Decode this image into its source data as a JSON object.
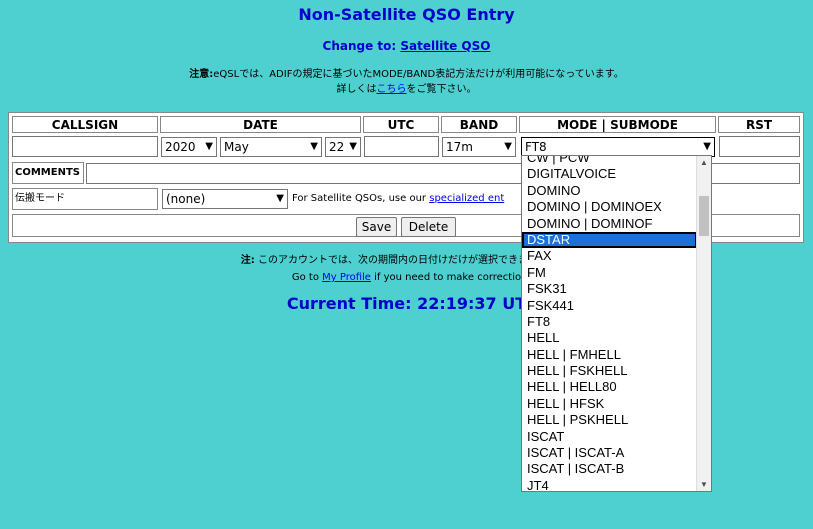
{
  "page": {
    "title": "Non-Satellite QSO Entry",
    "change_prefix": "Change to: ",
    "change_link": "Satellite QSO",
    "note1_bold": "注意:",
    "note1_text": "eQSLでは、ADIFの規定に基づいたMODE/BAND表記方法だけが利用可能になっています。",
    "note1_line2_pre": "詳しくは",
    "note1_line2_link": "こちら",
    "note1_line2_post": "をご覧下さい。",
    "note2_bold": "注:",
    "note2_text": " このアカウントでは、次の期間内の日付けだけが選択できます: 01-Fe",
    "note3_pre": "Go to ",
    "note3_link": "My Profile",
    "note3_post": " if you need to make correctio",
    "current_time": "Current Time: 22:19:37 UT"
  },
  "form": {
    "headers": {
      "callsign": "CALLSIGN",
      "date": "DATE",
      "utc": "UTC",
      "band": "BAND",
      "mode": "MODE | SUBMODE",
      "rst": "RST"
    },
    "callsign_value": "",
    "year": "2020",
    "month": "May",
    "day": "22",
    "utc_value": "",
    "band": "17m",
    "mode": "FT8",
    "rst_value": "",
    "comments_label": "COMMENTS",
    "comments_value": "",
    "prop_label": "伝搬モード",
    "prop_value": "(none)",
    "sat_note_pre": "For Satellite QSOs, use our ",
    "sat_note_link": "specialized ent",
    "save_label": "Save",
    "delete_label": "Delete"
  },
  "mode_dropdown": {
    "items": [
      "CW | PCW",
      "DIGITALVOICE",
      "DOMINO",
      "DOMINO | DOMINOEX",
      "DOMINO | DOMINOF",
      "DSTAR",
      "FAX",
      "FM",
      "FSK31",
      "FSK441",
      "FT8",
      "HELL",
      "HELL | FMHELL",
      "HELL | FSKHELL",
      "HELL | HELL80",
      "HELL | HFSK",
      "HELL | PSKHELL",
      "ISCAT",
      "ISCAT | ISCAT-A",
      "ISCAT | ISCAT-B",
      "JT4"
    ],
    "highlighted": "DSTAR"
  },
  "icons": {
    "chevron": "chevron-down-icon",
    "scroll_up": "scroll-up-icon",
    "scroll_down": "scroll-down-icon"
  }
}
